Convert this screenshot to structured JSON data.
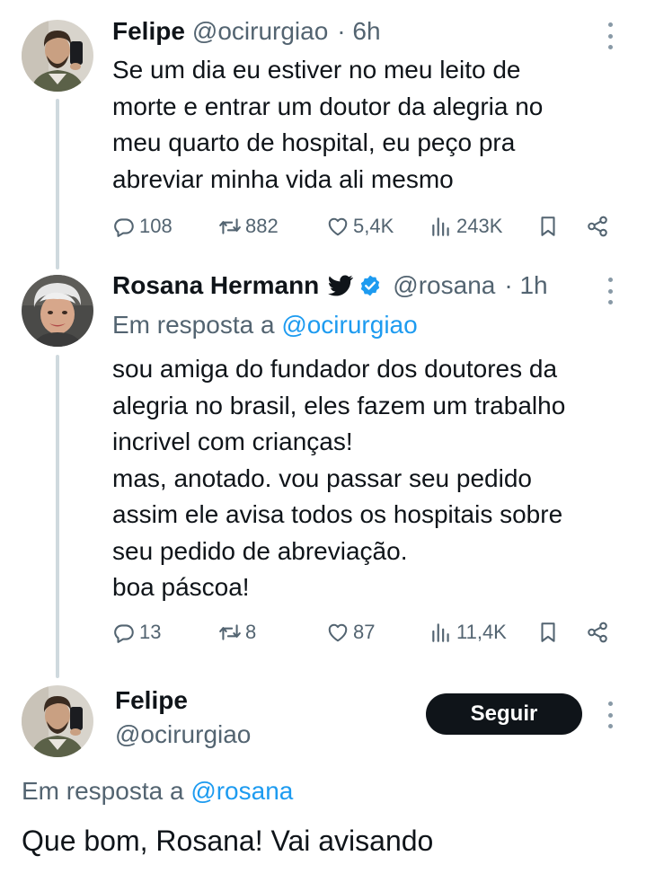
{
  "tweet1": {
    "name": "Felipe",
    "handle": "@ocirurgiao",
    "time": "· 6h",
    "lines": [
      "Se um dia eu estiver no meu leito de",
      "morte e entrar um doutor da alegria no",
      "meu quarto de hospital, eu peço pra",
      "abreviar minha vida ali mesmo"
    ],
    "replies": "108",
    "retweets": "882",
    "likes": "5,4K",
    "views": "243K"
  },
  "tweet2": {
    "name": "Rosana Hermann",
    "handle": "@rosana",
    "time": "· 1h",
    "reply_prefix": "Em resposta a",
    "reply_handle": "@ocirurgiao",
    "lines": [
      "sou amiga do fundador dos doutores da",
      "alegria no brasil, eles fazem um trabalho",
      "incrivel com crianças!",
      "mas, anotado. vou passar seu pedido",
      "assim ele avisa todos os hospitais sobre",
      "seu pedido de abreviação.",
      "boa páscoa!"
    ],
    "replies": "13",
    "retweets": "8",
    "likes": "87",
    "views": "11,4K"
  },
  "tweet3": {
    "name": "Felipe",
    "handle": "@ocirurgiao",
    "follow_label": "Seguir",
    "reply_prefix": "Em resposta a",
    "reply_handle": "@rosana",
    "text": "Que bom, Rosana! Vai avisando"
  },
  "colors": {
    "text": "#0f1419",
    "secondary": "#536471",
    "link": "#1d9bf0",
    "verified": "#1d9bf0",
    "thread_line": "#cfd9de"
  },
  "icons": {
    "reply": "reply-bubble-icon",
    "retweet": "retweet-icon",
    "like": "heart-icon",
    "views": "views-bars-icon",
    "bookmark": "bookmark-icon",
    "share": "share-icon",
    "more": "more-vertical-icon",
    "bird": "twitter-bird-icon",
    "verified": "verified-badge-icon"
  }
}
